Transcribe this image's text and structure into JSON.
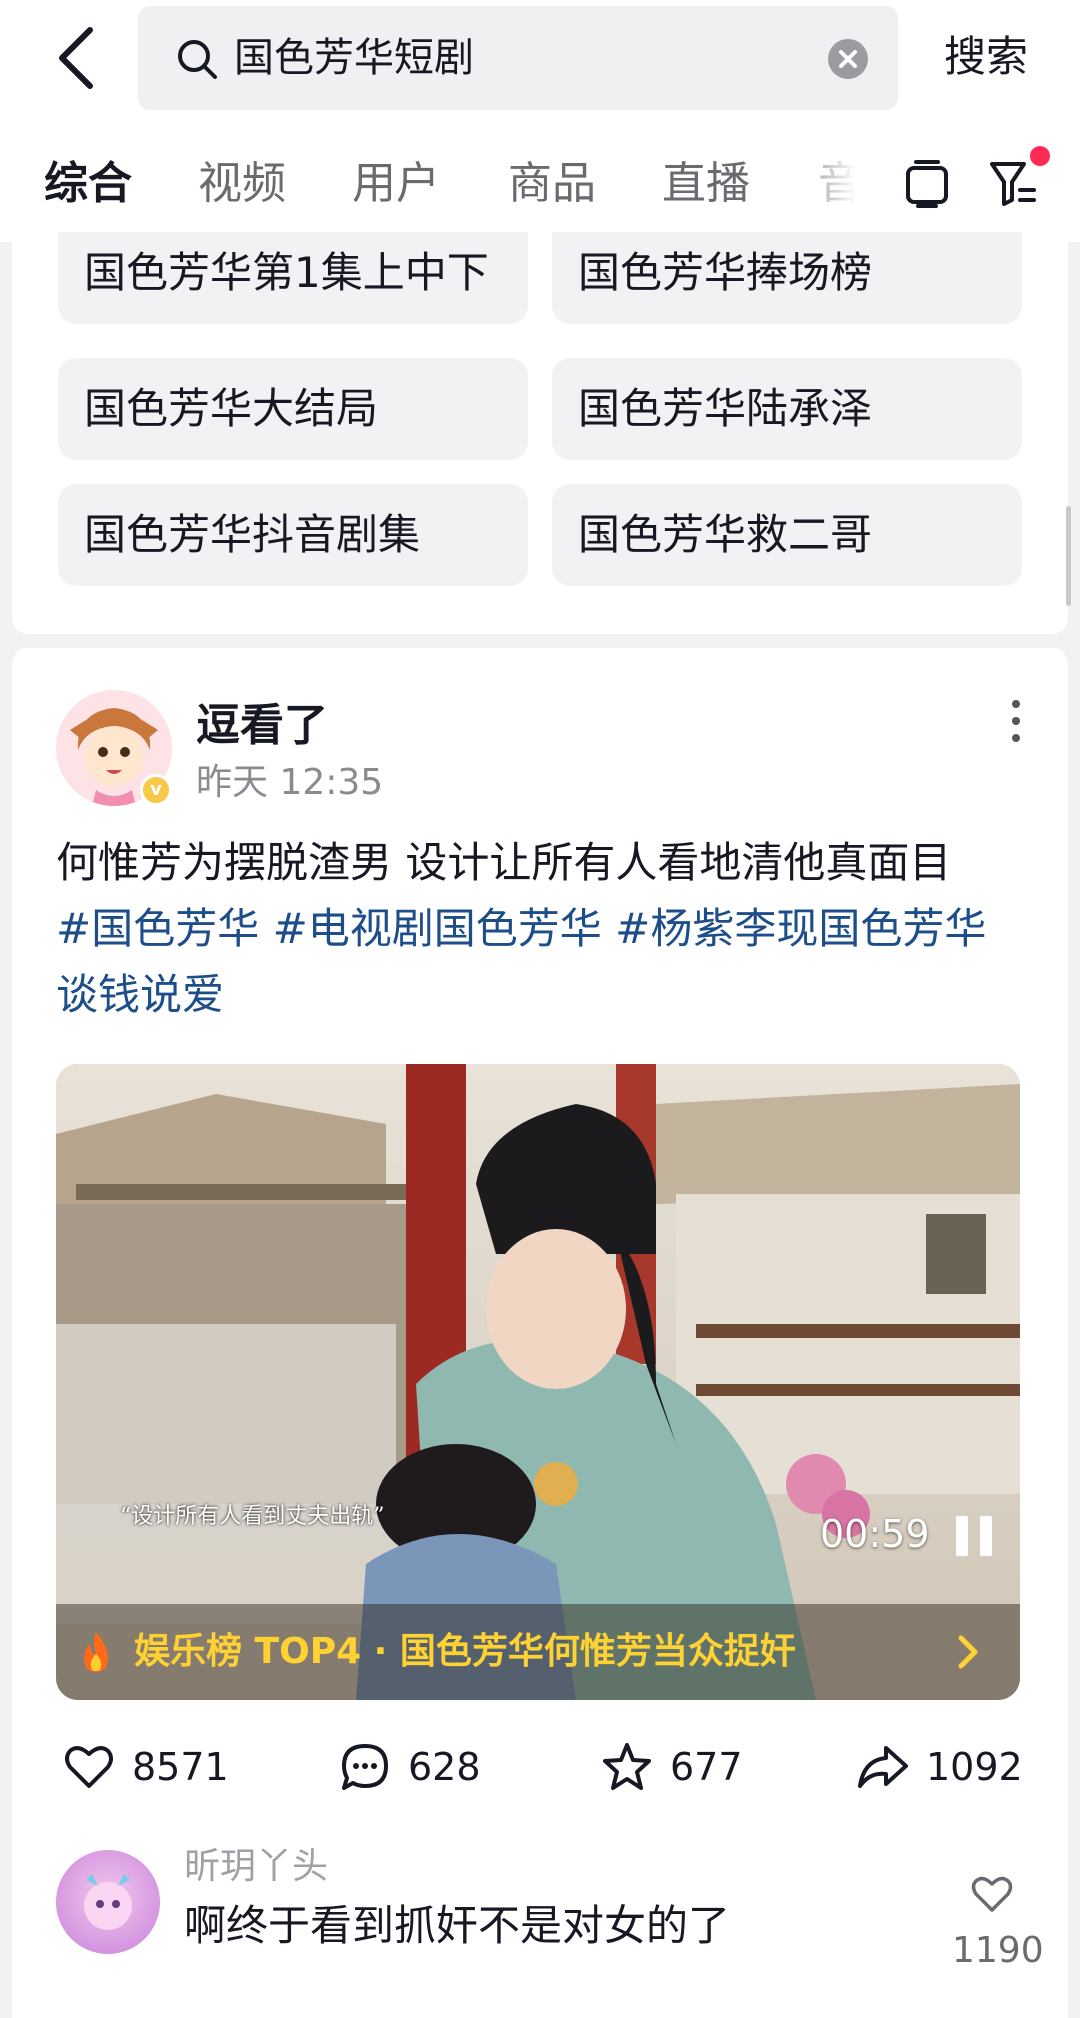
{
  "header": {
    "search_query": "国色芳华短剧",
    "search_button": "搜索"
  },
  "tabs": [
    {
      "label": "综合",
      "active": true
    },
    {
      "label": "视频"
    },
    {
      "label": "用户"
    },
    {
      "label": "商品"
    },
    {
      "label": "直播"
    },
    {
      "label": "音乐"
    }
  ],
  "related_searches": [
    "国色芳华第1集上中下",
    "国色芳华捧场榜",
    "国色芳华大结局",
    "国色芳华陆承泽",
    "国色芳华抖音剧集",
    "国色芳华救二哥"
  ],
  "post": {
    "author": "逗看了",
    "verified_badge": "v",
    "time": "昨天 12:35",
    "text": "何惟芳为摆脱渣男 设计让所有人看地清他真面目",
    "hashtags": [
      "#国色芳华",
      "#电视剧国色芳华",
      "#杨紫李现国色芳华"
    ],
    "trailing_text": "谈钱说爱",
    "video": {
      "subtitle": "“设计所有人看到丈夫出轨”",
      "duration": "00:59",
      "ranking": "娱乐榜 TOP4 · 国色芳华何惟芳当众捉奸"
    },
    "stats": {
      "likes": "8571",
      "comments": "628",
      "favorites": "677",
      "shares": "1092"
    }
  },
  "top_comment": {
    "user": "昕玥丫头",
    "text": "啊终于看到抓奸不是对女的了",
    "likes": "1190"
  },
  "colors": {
    "hashtag": "#1e4e8a",
    "rank_text": "#ffd233",
    "notification_dot": "#fe2c55"
  }
}
